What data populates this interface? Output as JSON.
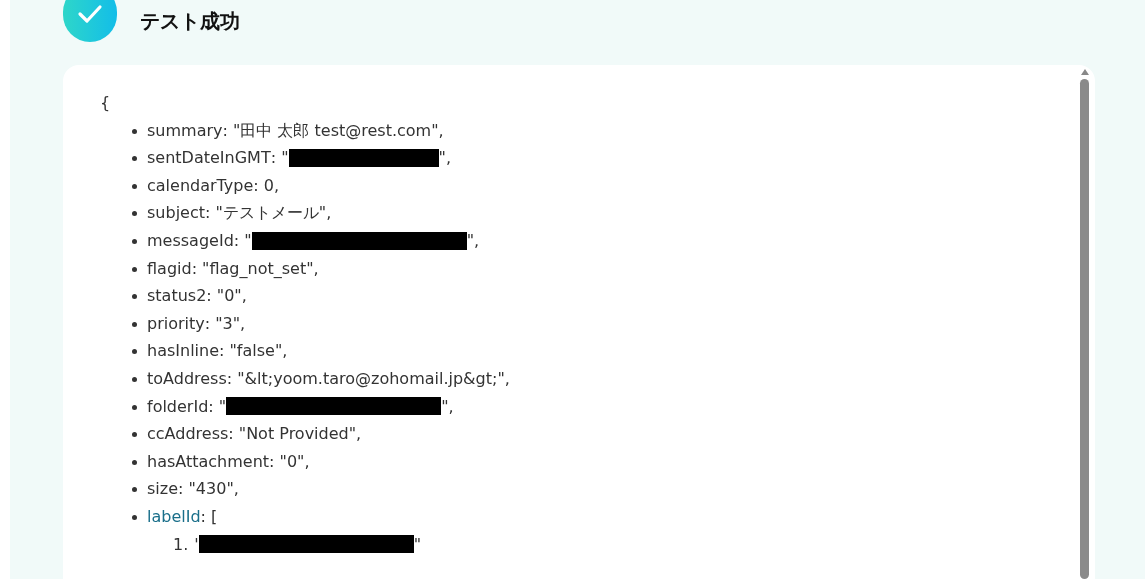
{
  "header": {
    "title": "テスト成功"
  },
  "result": {
    "open_brace": "{",
    "entries": [
      {
        "key": "summary",
        "value": ": \"田中 太郎 test@rest.com\","
      },
      {
        "key": "sentDateInGMT",
        "kind": "redacted",
        "before": ": \"",
        "after": "\","
      },
      {
        "key": "calendarType",
        "value": ": 0,"
      },
      {
        "key": "subject",
        "value": ": \"テストメール\","
      },
      {
        "key": "messageId",
        "kind": "redacted",
        "before": ": \"",
        "after": "\","
      },
      {
        "key": "flagid",
        "value": ": \"flag_not_set\","
      },
      {
        "key": "status2",
        "value": ": \"0\","
      },
      {
        "key": "priority",
        "value": ": \"3\","
      },
      {
        "key": "hasInline",
        "value": ": \"false\","
      },
      {
        "key": "toAddress",
        "value": ": \"&lt;yoom.taro@zohomail.jp&gt;\","
      },
      {
        "key": "folderId",
        "kind": "redacted",
        "before": ": \"",
        "after": "\","
      },
      {
        "key": "ccAddress",
        "value": ": \"Not Provided\","
      },
      {
        "key": "hasAttachment",
        "value": ": \"0\","
      },
      {
        "key": "size",
        "value": ": \"430\","
      },
      {
        "key": "labelId",
        "kind": "array",
        "linked": true,
        "value": ": [",
        "children": [
          {
            "number": "1.",
            "kind": "redacted",
            "before": "'",
            "after": "\""
          }
        ]
      }
    ]
  }
}
